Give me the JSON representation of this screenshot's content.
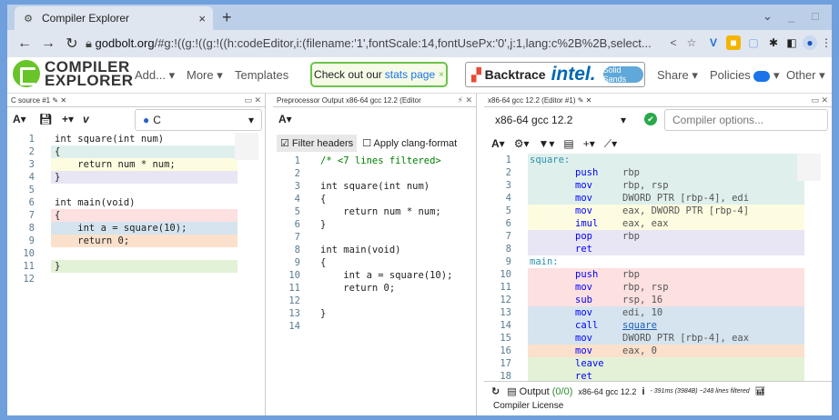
{
  "browser": {
    "tab_title": "Compiler Explorer",
    "url_host": "godbolt.org",
    "url_rest": "/#g:!((g:!((g:!((h:codeEditor,i:(filename:'1',fontScale:14,fontUsePx:'0',j:1,lang:c%2B%2B,select..."
  },
  "header": {
    "logo_line1": "COMPILER",
    "logo_line2": "EXPLORER",
    "add": "Add...",
    "more": "More",
    "templates": "Templates",
    "stats_prefix": "Check out our",
    "stats_link": "stats page",
    "stats_close": "×",
    "backtrace": "Backtrace",
    "intel": "intel.",
    "solid": "Solid Sands",
    "share": "Share",
    "policies": "Policies",
    "other": "Other"
  },
  "source": {
    "tab": "C source #1",
    "language": "C",
    "lines": [
      "int square(int num)",
      "{",
      "    return num * num;",
      "}",
      "",
      "int main(void)",
      "{",
      "    int a = square(10);",
      "    return 0;",
      "",
      "}",
      ""
    ],
    "colors": [
      "",
      "#dff0ec",
      "#fdfce0",
      "#e8e6f4",
      "",
      "",
      "#fde0e0",
      "#d5e4ef",
      "#fbe1cc",
      "",
      "#e3f2d6",
      ""
    ]
  },
  "preproc": {
    "tab": "Preprocessor Output x86-64 gcc 12.2 (Editor",
    "filter": "Filter headers",
    "clang": "Apply clang-format",
    "lines": [
      "/* <7 lines filtered>",
      "",
      "int square(int num)",
      "{",
      "    return num * num;",
      "}",
      "",
      "int main(void)",
      "{",
      "    int a = square(10);",
      "    return 0;",
      "",
      "}",
      ""
    ]
  },
  "asm": {
    "tab": "x86-64 gcc 12.2 (Editor #1)",
    "compiler": "x86-64 gcc 12.2",
    "options_placeholder": "Compiler options...",
    "lines": [
      {
        "l": "square:",
        "m": "",
        "o": ""
      },
      {
        "l": "",
        "m": "push",
        "o": "rbp"
      },
      {
        "l": "",
        "m": "mov",
        "o": "rbp, rsp"
      },
      {
        "l": "",
        "m": "mov",
        "o": "DWORD PTR [rbp-4], edi"
      },
      {
        "l": "",
        "m": "mov",
        "o": "eax, DWORD PTR [rbp-4]"
      },
      {
        "l": "",
        "m": "imul",
        "o": "eax, eax"
      },
      {
        "l": "",
        "m": "pop",
        "o": "rbp"
      },
      {
        "l": "",
        "m": "ret",
        "o": ""
      },
      {
        "l": "main:",
        "m": "",
        "o": ""
      },
      {
        "l": "",
        "m": "push",
        "o": "rbp"
      },
      {
        "l": "",
        "m": "mov",
        "o": "rbp, rsp"
      },
      {
        "l": "",
        "m": "sub",
        "o": "rsp, 16"
      },
      {
        "l": "",
        "m": "mov",
        "o": "edi, 10"
      },
      {
        "l": "",
        "m": "call",
        "o": "square"
      },
      {
        "l": "",
        "m": "mov",
        "o": "DWORD PTR [rbp-4], eax"
      },
      {
        "l": "",
        "m": "mov",
        "o": "eax, 0"
      },
      {
        "l": "",
        "m": "leave",
        "o": ""
      },
      {
        "l": "",
        "m": "ret",
        "o": ""
      }
    ],
    "colors": [
      "#dff0ec",
      "#dff0ec",
      "#dff0ec",
      "#dff0ec",
      "#fdfce0",
      "#fdfce0",
      "#e8e6f4",
      "#e8e6f4",
      "",
      "#fde0e0",
      "#fde0e0",
      "#fde0e0",
      "#d5e4ef",
      "#d5e4ef",
      "#d5e4ef",
      "#fbe1cc",
      "#e3f2d6",
      "#e3f2d6"
    ],
    "output_label": "Output",
    "output_count": "(0/0)",
    "output_compiler": "x86-64 gcc 12.2",
    "output_stats": "- 391ms (3984B) ~248 lines filtered",
    "license": "Compiler License"
  }
}
